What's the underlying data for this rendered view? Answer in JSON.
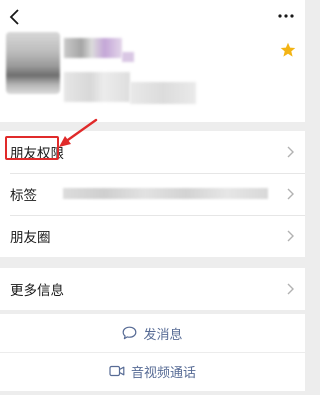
{
  "header": {
    "back_icon": "back-chevron-icon",
    "more_icon": "more-dots-icon",
    "star_icon": "star-icon",
    "star_color": "#f3b415"
  },
  "rows": [
    {
      "label": "朋友权限"
    },
    {
      "label": "标签"
    },
    {
      "label": "朋友圈"
    }
  ],
  "more_info": {
    "label": "更多信息"
  },
  "actions": {
    "message_label": "发消息",
    "call_label": "音视频通话",
    "accent": "#576b95"
  },
  "annotation": {
    "highlight_color": "#e02a2a"
  }
}
